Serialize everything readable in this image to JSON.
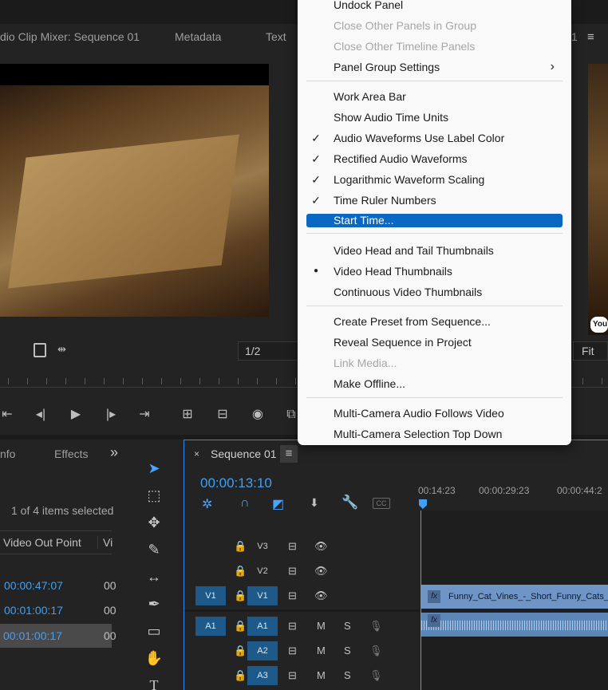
{
  "panel_tabs": {
    "audio_clip_mixer": "dio Clip Mixer: Sequence 01",
    "metadata": "Metadata",
    "text": "Text",
    "num": "1"
  },
  "program_monitor": {
    "fraction": "1/2",
    "fit": "Fit",
    "yt_badge": "You"
  },
  "menu": {
    "items": [
      {
        "label": "Undock Panel",
        "state": "normal"
      },
      {
        "label": "Close Other Panels in Group",
        "state": "disabled"
      },
      {
        "label": "Close Other Timeline Panels",
        "state": "disabled"
      },
      {
        "label": "Panel Group Settings",
        "state": "submenu"
      },
      {
        "label": "Work Area Bar",
        "state": "normal"
      },
      {
        "label": "Show Audio Time Units",
        "state": "normal"
      },
      {
        "label": "Audio Waveforms Use Label Color",
        "state": "checked"
      },
      {
        "label": "Rectified Audio Waveforms",
        "state": "checked"
      },
      {
        "label": "Logarithmic Waveform Scaling",
        "state": "checked"
      },
      {
        "label": "Time Ruler Numbers",
        "state": "checked"
      },
      {
        "label": "Start Time...",
        "state": "highlighted"
      },
      {
        "label": "Video Head and Tail Thumbnails",
        "state": "normal"
      },
      {
        "label": "Video Head Thumbnails",
        "state": "radio"
      },
      {
        "label": "Continuous Video Thumbnails",
        "state": "normal"
      },
      {
        "label": "Create Preset from Sequence...",
        "state": "normal"
      },
      {
        "label": "Reveal Sequence in Project",
        "state": "normal"
      },
      {
        "label": "Link Media...",
        "state": "disabled"
      },
      {
        "label": "Make Offline...",
        "state": "normal"
      },
      {
        "label": "Multi-Camera Audio Follows Video",
        "state": "normal"
      },
      {
        "label": "Multi-Camera Selection Top Down",
        "state": "normal"
      }
    ],
    "check_glyph": "✓",
    "radio_glyph": "●",
    "submenu_glyph": "›"
  },
  "project": {
    "tab_info": "nfo",
    "tab_effects": "Effects",
    "more": "»",
    "selection": "1 of 4 items selected",
    "col_out": "Video Out Point",
    "col_next": "Vi",
    "rows": [
      {
        "out": "00:00:47:07",
        "next": "00"
      },
      {
        "out": "00:01:00:17",
        "next": "00"
      },
      {
        "out": "00:01:00:17",
        "next": "00"
      }
    ]
  },
  "timeline": {
    "close": "×",
    "sequence_name": "Sequence 01",
    "menu_glyph": "≡",
    "timecode": "00:00:13:10",
    "ruler_labels": [
      "00:14:23",
      "00:00:29:23",
      "00:00:44:2"
    ],
    "tracks": [
      {
        "src": "",
        "name": "V3",
        "type": "video"
      },
      {
        "src": "",
        "name": "V2",
        "type": "video"
      },
      {
        "src": "V1",
        "name": "V1",
        "type": "video"
      },
      {
        "src": "A1",
        "name": "A1",
        "type": "audio"
      },
      {
        "src": "",
        "name": "A2",
        "type": "audio"
      },
      {
        "src": "",
        "name": "A3",
        "type": "audio"
      }
    ],
    "mute": "M",
    "solo": "S",
    "fx": "fx",
    "clip_name": "Funny_Cat_Vines_-_Short_Funny_Cats_Y"
  },
  "colors": {
    "accent": "#2d8ceb",
    "highlight": "#0a67c2",
    "track_on": "#1d5a8a",
    "timecode": "#3fa0f5"
  }
}
